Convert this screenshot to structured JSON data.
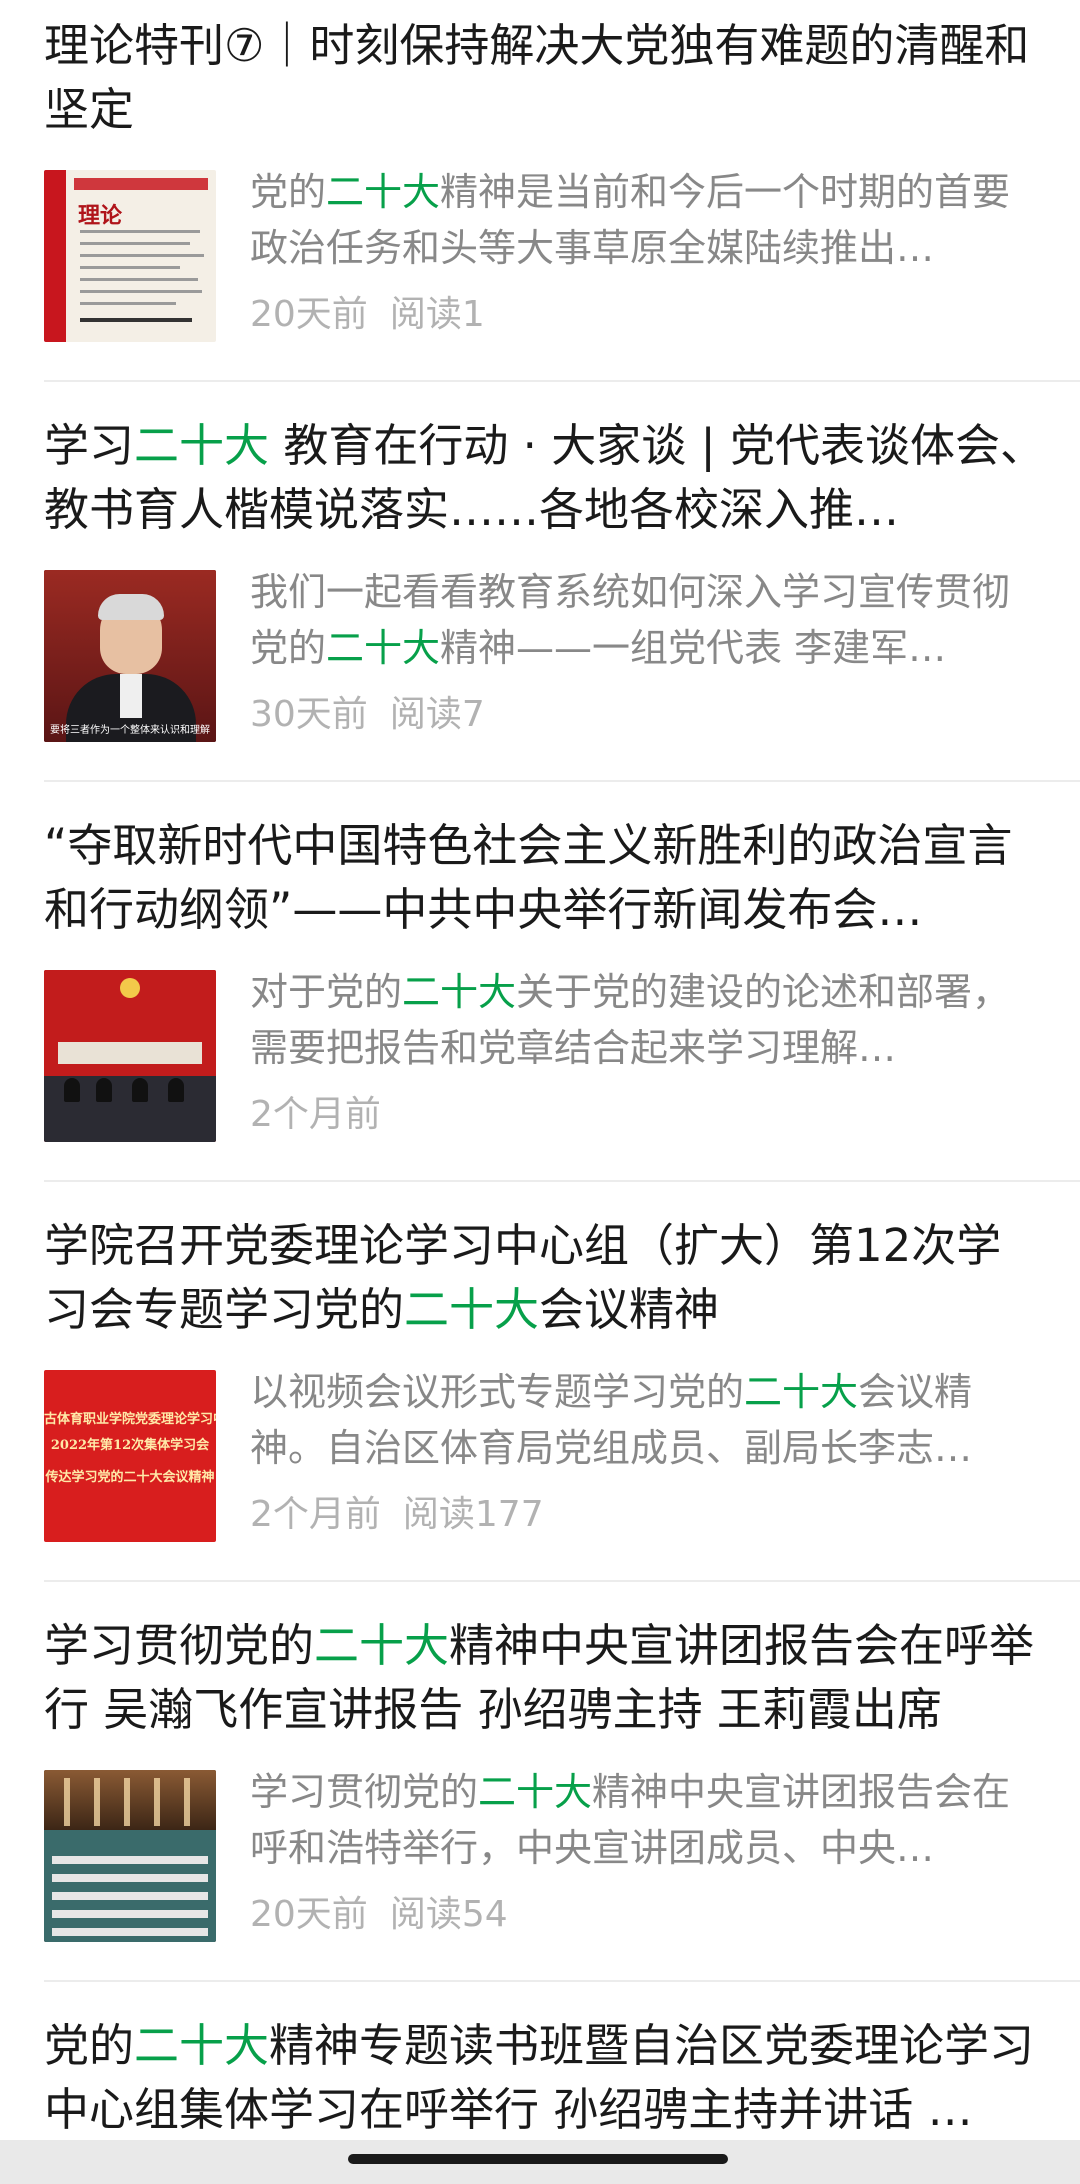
{
  "articles": [
    {
      "title": [
        {
          "text": "理论特刊⑦｜时刻保持解决大党独有难题的清醒和坚定",
          "hl": false
        }
      ],
      "summary": [
        {
          "text": "党的",
          "hl": false
        },
        {
          "text": "二十大",
          "hl": true
        },
        {
          "text": "精神是当前和今后一个时期的首要政治任务和头等大事草原全媒陆续推出…",
          "hl": false
        }
      ],
      "time": "20天前",
      "reads": "阅读1"
    },
    {
      "title": [
        {
          "text": "学习",
          "hl": false
        },
        {
          "text": "二十大",
          "hl": true
        },
        {
          "text": " 教育在行动 · 大家谈 | 党代表谈体会、教书育人楷模说落实……各地各校深入推…",
          "hl": false
        }
      ],
      "summary": [
        {
          "text": "我们一起看看教育系统如何深入学习宣传贯彻党的",
          "hl": false
        },
        {
          "text": "二十大",
          "hl": true
        },
        {
          "text": "精神——一组党代表 李建军…",
          "hl": false
        }
      ],
      "time": "30天前",
      "reads": "阅读7",
      "thumb_caption": "要将三者作为一个整体来认识和理解"
    },
    {
      "title": [
        {
          "text": "“夺取新时代中国特色社会主义新胜利的政治宣言和行动纲领”——中共中央举行新闻发布会…",
          "hl": false
        }
      ],
      "summary": [
        {
          "text": "对于党的",
          "hl": false
        },
        {
          "text": "二十大",
          "hl": true
        },
        {
          "text": "关于党的建设的论述和部署，需要把报告和党章结合起来学习理解…",
          "hl": false
        }
      ],
      "time": "2个月前",
      "reads": ""
    },
    {
      "title": [
        {
          "text": "学院召开党委理论学习中心组（扩大）第12次学习会专题学习党的",
          "hl": false
        },
        {
          "text": "二十大",
          "hl": true
        },
        {
          "text": "会议精神",
          "hl": false
        }
      ],
      "summary": [
        {
          "text": "以视频会议形式专题学习党的",
          "hl": false
        },
        {
          "text": "二十大",
          "hl": true
        },
        {
          "text": "会议精神。自治区体育局党组成员、副局长李志…",
          "hl": false
        }
      ],
      "time": "2个月前",
      "reads": "阅读177",
      "thumb_lines": [
        "古体育职业学院党委理论学习中",
        "2022年第12次集体学习会",
        "传达学习党的二十大会议精神"
      ]
    },
    {
      "title": [
        {
          "text": "学习贯彻党的",
          "hl": false
        },
        {
          "text": "二十大",
          "hl": true
        },
        {
          "text": "精神中央宣讲团报告会在呼举行 吴瀚飞作宣讲报告 孙绍骋主持 王莉霞出席",
          "hl": false
        }
      ],
      "summary": [
        {
          "text": "学习贯彻党的",
          "hl": false
        },
        {
          "text": "二十大",
          "hl": true
        },
        {
          "text": "精神中央宣讲团报告会在呼和浩特举行，中央宣讲团成员、中央…",
          "hl": false
        }
      ],
      "time": "20天前",
      "reads": "阅读54"
    },
    {
      "title": [
        {
          "text": "党的",
          "hl": false
        },
        {
          "text": "二十大",
          "hl": true
        },
        {
          "text": "精神专题读书班暨自治区党委理论学习中心组集体学习在呼举行 孙绍骋主持并讲话 …",
          "hl": false
        }
      ],
      "summary": [],
      "time": "",
      "reads": ""
    }
  ]
}
